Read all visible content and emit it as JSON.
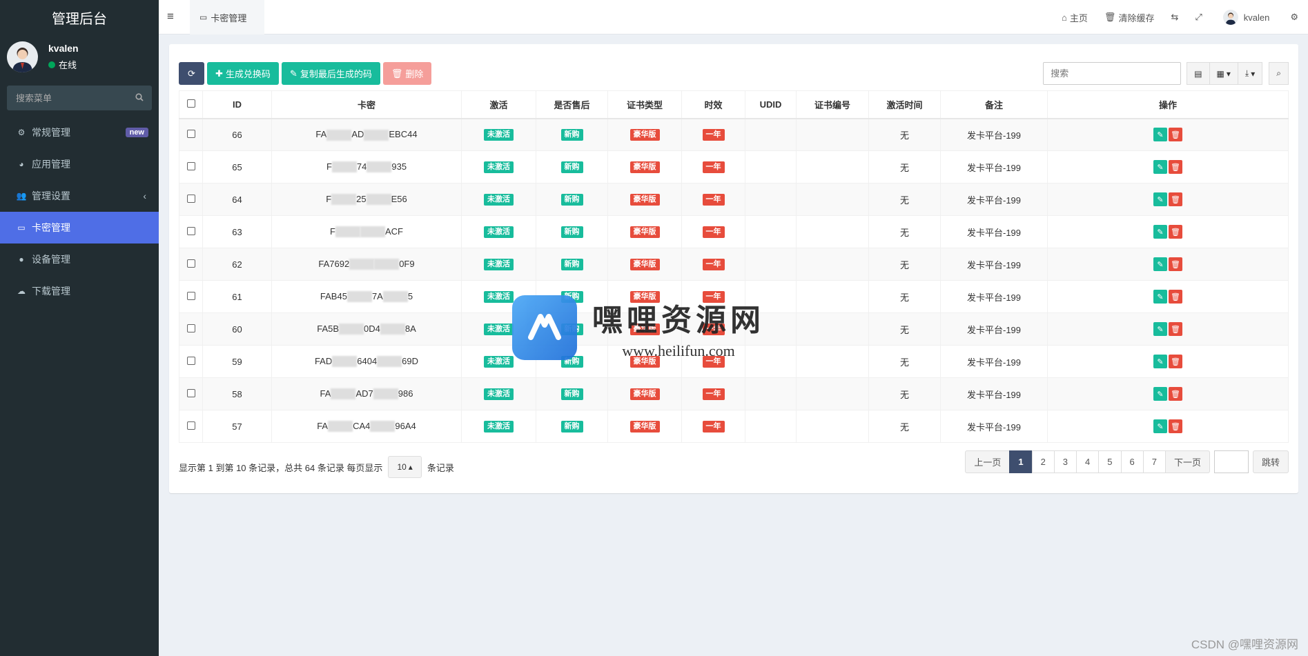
{
  "sidebar": {
    "title": "管理后台",
    "user": {
      "name": "kvalen",
      "status": "在线"
    },
    "search_placeholder": "搜索菜单",
    "items": [
      {
        "label": "常规管理",
        "icon": "gears-icon",
        "badge": "new"
      },
      {
        "label": "应用管理",
        "icon": "dashboard-icon"
      },
      {
        "label": "管理设置",
        "icon": "users-icon"
      },
      {
        "label": "卡密管理",
        "icon": "credit-card-icon"
      },
      {
        "label": "设备管理",
        "icon": "apple-icon"
      },
      {
        "label": "下载管理",
        "icon": "cloud-download-icon"
      }
    ]
  },
  "topbar": {
    "tab_label": "卡密管理",
    "home": "主页",
    "clear_cache": "清除缓存",
    "user_name": "kvalen"
  },
  "toolbar": {
    "generate": "生成兑换码",
    "copy_last": "复制最后生成的码",
    "delete": "删除",
    "search_placeholder": "搜索"
  },
  "table": {
    "headers": [
      "ID",
      "卡密",
      "激活",
      "是否售后",
      "证书类型",
      "时效",
      "UDID",
      "证书编号",
      "激活时间",
      "备注",
      "操作"
    ],
    "rows": [
      {
        "id": "66",
        "code_a": "FA",
        "code_b": "AD",
        "code_c": "EBC44",
        "active": "未激活",
        "after": "新购",
        "cert": "豪华版",
        "period": "一年",
        "udid": "",
        "certno": "",
        "time": "无",
        "note": "发卡平台-199"
      },
      {
        "id": "65",
        "code_a": "F",
        "code_b": "74",
        "code_c": "935",
        "active": "未激活",
        "after": "新购",
        "cert": "豪华版",
        "period": "一年",
        "udid": "",
        "certno": "",
        "time": "无",
        "note": "发卡平台-199"
      },
      {
        "id": "64",
        "code_a": "F",
        "code_b": "25",
        "code_c": "E56",
        "active": "未激活",
        "after": "新购",
        "cert": "豪华版",
        "period": "一年",
        "udid": "",
        "certno": "",
        "time": "无",
        "note": "发卡平台-199"
      },
      {
        "id": "63",
        "code_a": "F",
        "code_b": "",
        "code_c": "ACF",
        "active": "未激活",
        "after": "新购",
        "cert": "豪华版",
        "period": "一年",
        "udid": "",
        "certno": "",
        "time": "无",
        "note": "发卡平台-199"
      },
      {
        "id": "62",
        "code_a": "FA7692",
        "code_b": "",
        "code_c": "0F9",
        "active": "未激活",
        "after": "新购",
        "cert": "豪华版",
        "period": "一年",
        "udid": "",
        "certno": "",
        "time": "无",
        "note": "发卡平台-199"
      },
      {
        "id": "61",
        "code_a": "FAB45",
        "code_b": "7A",
        "code_c": "5",
        "active": "未激活",
        "after": "新购",
        "cert": "豪华版",
        "period": "一年",
        "udid": "",
        "certno": "",
        "time": "无",
        "note": "发卡平台-199"
      },
      {
        "id": "60",
        "code_a": "FA5B",
        "code_b": "0D4",
        "code_c": "8A",
        "active": "未激活",
        "after": "新购",
        "cert": "豪华版",
        "period": "一年",
        "udid": "",
        "certno": "",
        "time": "无",
        "note": "发卡平台-199"
      },
      {
        "id": "59",
        "code_a": "FAD",
        "code_b": "6404",
        "code_c": "69D",
        "active": "未激活",
        "after": "新购",
        "cert": "豪华版",
        "period": "一年",
        "udid": "",
        "certno": "",
        "time": "无",
        "note": "发卡平台-199"
      },
      {
        "id": "58",
        "code_a": "FA",
        "code_b": "AD7",
        "code_c": "986",
        "active": "未激活",
        "after": "新购",
        "cert": "豪华版",
        "period": "一年",
        "udid": "",
        "certno": "",
        "time": "无",
        "note": "发卡平台-199"
      },
      {
        "id": "57",
        "code_a": "FA",
        "code_b": "CA4",
        "code_c": "96A4",
        "active": "未激活",
        "after": "新购",
        "cert": "豪华版",
        "period": "一年",
        "udid": "",
        "certno": "",
        "time": "无",
        "note": "发卡平台-199"
      }
    ]
  },
  "pagination": {
    "info_prefix": "显示第 1 到第 10 条记录，总共 64 条记录 每页显示",
    "page_size": "10",
    "info_suffix": "条记录",
    "prev": "上一页",
    "pages": [
      "1",
      "2",
      "3",
      "4",
      "5",
      "6",
      "7"
    ],
    "current": "1",
    "next": "下一页",
    "jump": "跳转"
  },
  "watermark": {
    "title": "嘿哩资源网",
    "url": "www.heilifun.com"
  },
  "csdn_mark": "CSDN @嘿哩资源网",
  "colors": {
    "sidebar": "#222d32",
    "active_menu": "#4f6ee6",
    "green": "#18bc9c",
    "red": "#e74c3c",
    "dark_btn": "#3e4e6e"
  }
}
